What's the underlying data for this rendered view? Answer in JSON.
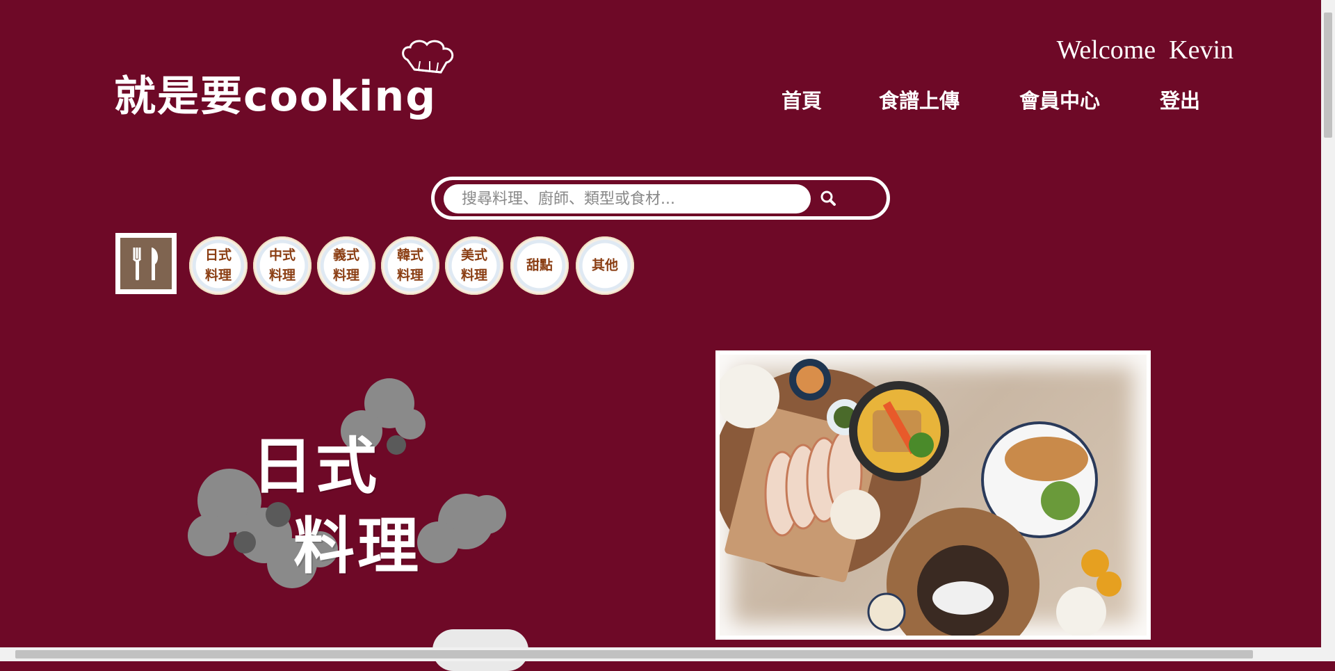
{
  "header": {
    "logo_text": "就是要cooking",
    "welcome": "Welcome  Kevin",
    "nav": [
      {
        "label": "首頁"
      },
      {
        "label": "食譜上傳"
      },
      {
        "label": "會員中心"
      },
      {
        "label": "登出"
      }
    ]
  },
  "search": {
    "placeholder": "搜尋料理、廚師、類型或食材..."
  },
  "categories": [
    {
      "label": "日式\n料理"
    },
    {
      "label": "中式\n料理"
    },
    {
      "label": "義式\n料理"
    },
    {
      "label": "韓式\n料理"
    },
    {
      "label": "美式\n料理"
    },
    {
      "label": "甜點"
    },
    {
      "label": "其他"
    }
  ],
  "hero": {
    "line1": "日式",
    "line2": "料理"
  },
  "colors": {
    "background": "#6e0927",
    "category_text": "#8a3d12",
    "all_tile": "#7f6450"
  },
  "icons": {
    "logo": "chef-hat-icon",
    "search": "search-icon",
    "all_categories": "fork-knife-icon"
  }
}
